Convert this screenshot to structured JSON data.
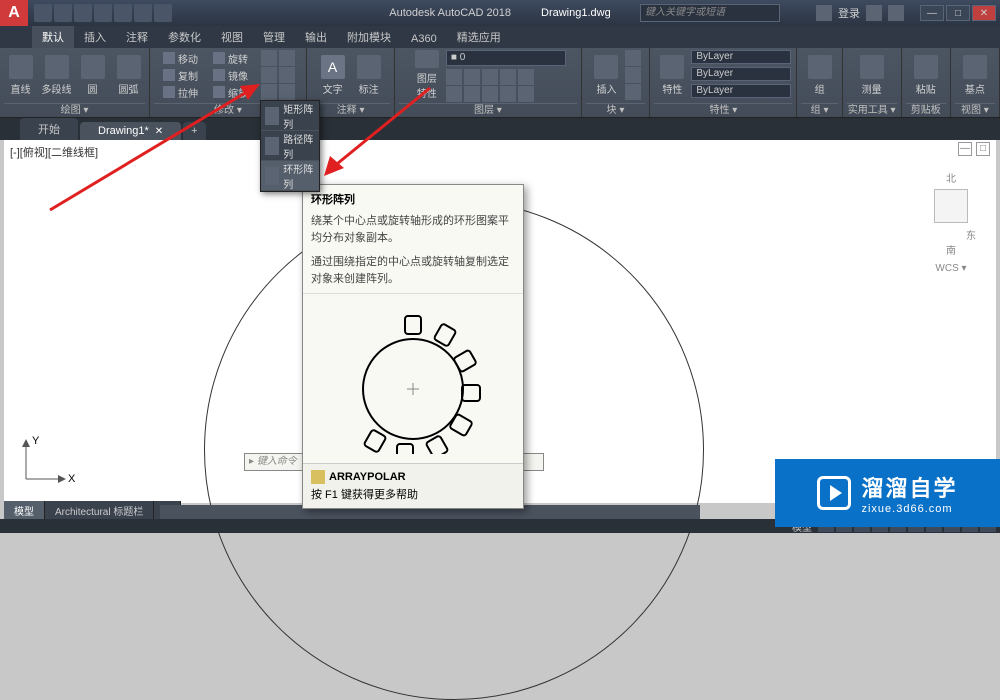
{
  "title": {
    "app": "Autodesk AutoCAD 2018",
    "file": "Drawing1.dwg"
  },
  "search_placeholder": "键入关键字或短语",
  "user_label": "登录",
  "ribbon_tabs": [
    "默认",
    "插入",
    "注释",
    "参数化",
    "视图",
    "管理",
    "输出",
    "附加模块",
    "A360",
    "精选应用"
  ],
  "panels": {
    "draw": "绘图 ▾",
    "modify": "修改 ▾",
    "annotation": "注释 ▾",
    "layers": "图层 ▾",
    "block": "块 ▾",
    "properties": "特性 ▾",
    "groups": "组 ▾",
    "utilities": "实用工具 ▾",
    "clipboard": "剪贴板",
    "view": "视图 ▾"
  },
  "draw_btns": {
    "line": "直线",
    "polyline": "多段线",
    "circle": "圆",
    "arc": "圆弧"
  },
  "modify_btns": {
    "move": "移动",
    "rotate": "旋转",
    "copy": "复制",
    "mirror": "镜像",
    "stretch": "拉伸",
    "scale": "缩放"
  },
  "anno_btns": {
    "text": "文字",
    "dim": "标注"
  },
  "layer_btn": "图层\n特性",
  "layer_value": "■ 0",
  "block_btn": "插入",
  "props_btn": "特性",
  "prop_values": [
    "ByLayer",
    "ByLayer",
    "ByLayer"
  ],
  "group_btn": "组",
  "util_btn": "测量",
  "clip_btn": "粘贴",
  "view_btn": "基点",
  "file_tabs": {
    "start": "开始",
    "drawing": "Drawing1*"
  },
  "viewport_label": "[-][俯视][二维线框]",
  "viewcube": {
    "n": "北",
    "e": "东",
    "s": "南",
    "wcs": "WCS ▾"
  },
  "ucs": {
    "x": "X",
    "y": "Y"
  },
  "array_menu": {
    "rect": "矩形阵列",
    "path": "路径阵列",
    "polar": "环形阵列"
  },
  "tooltip": {
    "title": "环形阵列",
    "line1": "绕某个中心点或旋转轴形成的环形图案平均分布对象副本。",
    "line2": "通过围绕指定的中心点或旋转轴复制选定对象来创建阵列。",
    "cmd": "ARRAYPOLAR",
    "help": "按 F1 键获得更多帮助"
  },
  "cmdline_placeholder": "键入命令",
  "bottom_tabs": {
    "model": "模型",
    "layout": "Architectural 标题栏"
  },
  "status_model": "模型",
  "watermark": {
    "main": "溜溜自学",
    "sub": "zixue.3d66.com"
  }
}
